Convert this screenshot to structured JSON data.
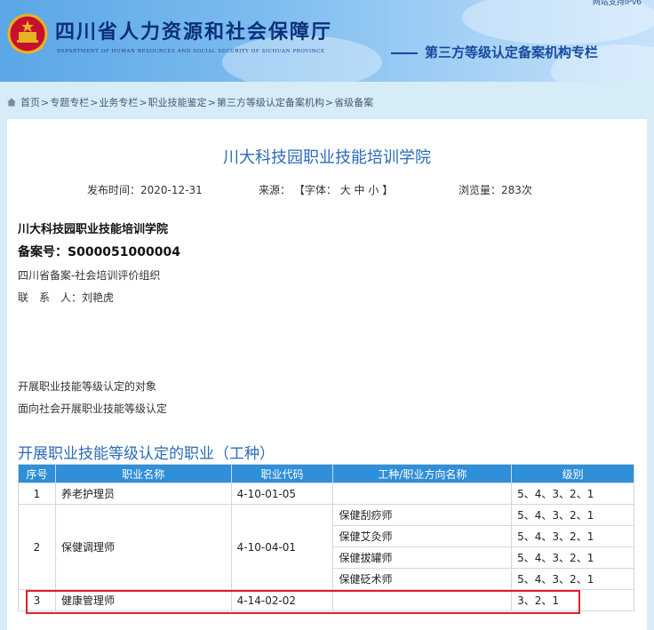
{
  "header": {
    "site_title": "四川省人力资源和社会保障厅",
    "site_subtitle": "DEPARTMENT OF HUMAN RESOURCES AND SOCIAL SECURITY OF SICHUAN PROVINCE",
    "column_title": "第三方等级认定备案机构专栏",
    "top_right_text": "网站支持IPv6",
    "emblem_icon": "national-emblem-icon"
  },
  "breadcrumb": {
    "home_icon": "home-icon",
    "separator": ">",
    "items": [
      "首页",
      "专题专栏",
      "业务专栏",
      "职业技能鉴定",
      "第三方等级认定备案机构",
      "省级备案"
    ]
  },
  "article": {
    "title": "川大科技园职业技能培训学院",
    "publish_label": "发布时间：",
    "publish_date": "2020-12-31",
    "source_label": "来源：",
    "font_label": "【字体：",
    "font_large": "大",
    "font_medium": "中",
    "font_small": "小",
    "font_close": "】",
    "views_label": "浏览量：",
    "views_count": "283次",
    "org_name": "川大科技园职业技能培训学院",
    "record_no": "备案号：S000051000004",
    "record_type": "四川省备案-社会培训评价组织",
    "contact": "联　系　人：刘艳虎",
    "scope_line1": "开展职业技能等级认定的对象",
    "scope_line2": "面向社会开展职业技能等级认定",
    "section_heading": "开展职业技能等级认定的职业（工种）"
  },
  "table": {
    "headers": [
      "序号",
      "职业名称",
      "职业代码",
      "工种/职业方向名称",
      "级别"
    ],
    "rows": [
      {
        "no": "1",
        "name": "养老护理员",
        "code": "4-10-01-05",
        "sub": [
          {
            "type": "",
            "level": "5、4、3、2、1"
          }
        ]
      },
      {
        "no": "2",
        "name": "保健调理师",
        "code": "4-10-04-01",
        "sub": [
          {
            "type": "保健刮痧师",
            "level": "5、4、3、2、1"
          },
          {
            "type": "保健艾灸师",
            "level": "5、4、3、2、1"
          },
          {
            "type": "保健拔罐师",
            "level": "5、4、3、2、1"
          },
          {
            "type": "保健砭术师",
            "level": "5、4、3、2、1"
          }
        ]
      },
      {
        "no": "3",
        "name": "健康管理师",
        "code": "4-14-02-02",
        "sub": [
          {
            "type": "",
            "level": "3、2、1"
          }
        ]
      }
    ]
  },
  "colors": {
    "accent_blue": "#2b6cb7",
    "table_header": "#2f8fd8",
    "highlight_red": "#e0202a"
  }
}
